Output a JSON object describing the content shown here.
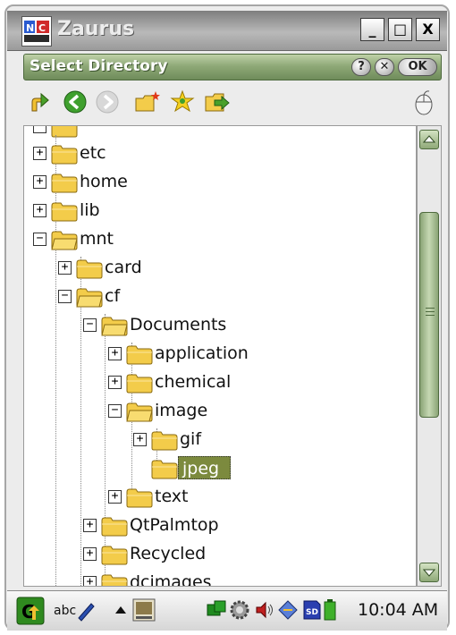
{
  "window": {
    "title": "Zaurus",
    "minimize_glyph": "_",
    "maximize_glyph": "□",
    "close_glyph": "X"
  },
  "dialog": {
    "title": "Select Directory",
    "help_glyph": "?",
    "close_glyph": "✕",
    "ok_label": "OK"
  },
  "toolbar": {
    "icons": [
      "go-up-icon",
      "back-icon",
      "forward-icon",
      "new-folder-icon",
      "bookmark-star-icon",
      "open-folder-icon",
      "mouse-icon"
    ]
  },
  "tree": {
    "items": [
      {
        "label": "etc",
        "expander": "+"
      },
      {
        "label": "home",
        "expander": "+"
      },
      {
        "label": "lib",
        "expander": "+"
      },
      {
        "label": "mnt",
        "expander": "−"
      },
      {
        "label": "card",
        "expander": "+"
      },
      {
        "label": "cf",
        "expander": "−"
      },
      {
        "label": "Documents",
        "expander": "−"
      },
      {
        "label": "application",
        "expander": "+"
      },
      {
        "label": "chemical",
        "expander": "+"
      },
      {
        "label": "image",
        "expander": "−"
      },
      {
        "label": "gif",
        "expander": "+"
      },
      {
        "label": "jpeg",
        "expander": "",
        "selected": true
      },
      {
        "label": "text",
        "expander": "+"
      },
      {
        "label": "QtPalmtop",
        "expander": "+"
      },
      {
        "label": "Recycled",
        "expander": "+"
      },
      {
        "label": "dcimages",
        "expander": "+"
      }
    ]
  },
  "taskbar": {
    "input_method": "abc",
    "time": "10:04 AM",
    "tray_icons": [
      "network-icon",
      "settings-gear-icon",
      "volume-icon",
      "pen-icon",
      "sd-card-icon",
      "battery-icon"
    ]
  },
  "colors": {
    "accent_green": "#8fa978",
    "selection": "#7c8a3e",
    "folder_yellow": "#f3cc4a"
  }
}
